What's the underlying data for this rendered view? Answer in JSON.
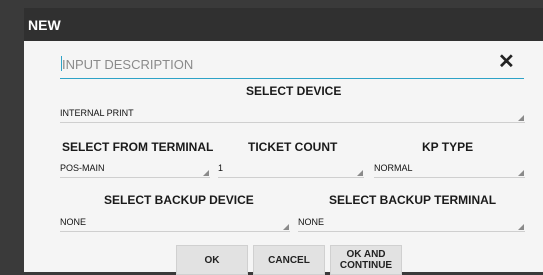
{
  "dialog": {
    "title": "NEW"
  },
  "description": {
    "placeholder": "INPUT DESCRIPTION",
    "value": ""
  },
  "close_icon": "close-icon",
  "select_device": {
    "label": "SELECT DEVICE",
    "value": "INTERNAL PRINT"
  },
  "select_from_terminal": {
    "label": "SELECT FROM TERMINAL",
    "value": "POS-MAIN"
  },
  "ticket_count": {
    "label": "TICKET COUNT",
    "value": "1"
  },
  "kp_type": {
    "label": "KP TYPE",
    "value": "NORMAL"
  },
  "select_backup_device": {
    "label": "SELECT BACKUP DEVICE",
    "value": "NONE"
  },
  "select_backup_terminal": {
    "label": "SELECT BACKUP TERMINAL",
    "value": "NONE"
  },
  "buttons": {
    "ok": "OK",
    "cancel": "CANCEL",
    "ok_and_continue": "OK AND CONTINUE"
  },
  "colors": {
    "titlebar": "#303030",
    "accent": "#2ea3c7",
    "background": "#f5f5f5",
    "button": "#e2e2e2"
  }
}
